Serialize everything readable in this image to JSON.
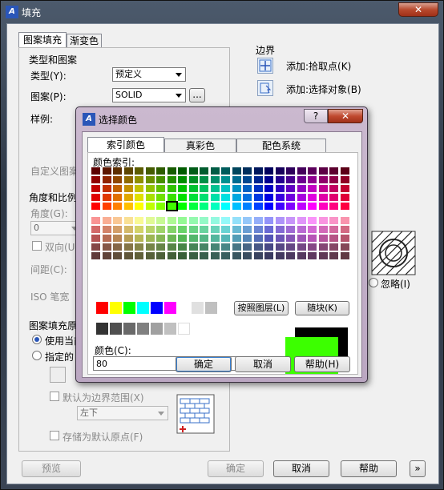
{
  "outer": {
    "title": "填充",
    "close_label": "✕",
    "tabs": [
      "图案填充",
      "渐变色"
    ],
    "group_type": {
      "title": "类型和图案",
      "type_label": "类型(Y):",
      "type_value": "预定义",
      "pattern_label": "图案(P):",
      "pattern_value": "SOLID",
      "pattern_browse": "...",
      "swatch_label": "样例:",
      "custom_label": "自定义图案"
    },
    "group_angle": {
      "title": "角度和比例",
      "angle_label": "角度(G):",
      "angle_value": "0",
      "double_label": "双向(U)",
      "spacing_label": "间距(C):",
      "iso_label": "ISO 笔宽"
    },
    "group_origin": {
      "title": "图案填充原",
      "use_current_label": "使用当前",
      "specified_label": "指定的",
      "default_boundary_label": "默认为边界范围(X)",
      "position_value": "左下",
      "store_default_label": "存储为默认原点(F)"
    },
    "boundary": {
      "title": "边界",
      "pick_points_label": "添加:拾取点(K)",
      "select_objects_label": "添加:选择对象(B)"
    },
    "island": {
      "ignore_label": "忽略(I)"
    },
    "buttons": {
      "preview": "预览",
      "ok": "确定",
      "cancel": "取消",
      "help": "帮助",
      "more": "»"
    }
  },
  "dialog": {
    "title": "选择颜色",
    "help_label": "?",
    "close_label": "✕",
    "tabs": [
      "索引颜色",
      "真彩色",
      "配色系统"
    ],
    "active_tab": "索引颜色",
    "index_label": "颜色索引:",
    "bylayer_label": "按照图层(L)",
    "byblock_label": "随块(K)",
    "color_label": "颜色(C):",
    "color_value": "80",
    "ok_label": "确定",
    "cancel_label": "取消",
    "help_button_label": "帮助(H)",
    "selected_color": "#3cff00",
    "previous_color": "#000000",
    "standard_colors": [
      "#ff0000",
      "#ffff00",
      "#00ff00",
      "#00ffff",
      "#0000ff",
      "#ff00ff",
      "#ffffff",
      "#e0e0e0",
      "#c0c0c0"
    ],
    "gray_colors": [
      "#333333",
      "#505050",
      "#696969",
      "#808080",
      "#a0a0a0",
      "#c0c0c0",
      "#ffffff"
    ]
  }
}
